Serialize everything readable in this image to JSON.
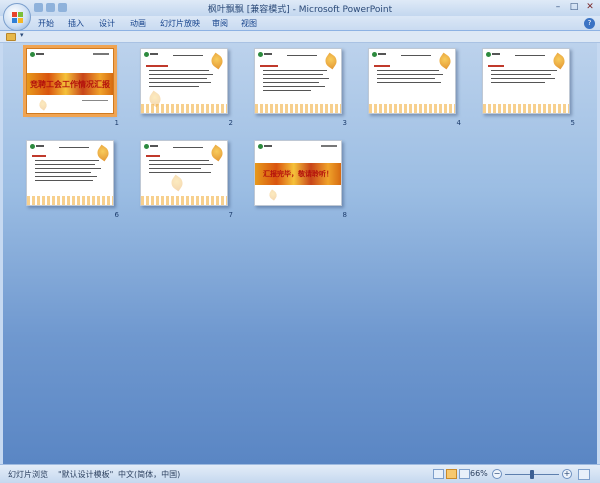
{
  "window": {
    "title": "枫叶飘飘 [兼容模式] - Microsoft PowerPoint",
    "controls": {
      "minimize": "–",
      "maximize": "□",
      "close": "✕"
    }
  },
  "ribbon": {
    "tabs": [
      {
        "label": "开始"
      },
      {
        "label": "插入"
      },
      {
        "label": "设计"
      },
      {
        "label": "动画"
      },
      {
        "label": "幻灯片放映"
      },
      {
        "label": "审阅"
      },
      {
        "label": "视图"
      }
    ],
    "help": "?"
  },
  "quick_access": {
    "dropdown": "▾"
  },
  "slides": [
    {
      "number": "1",
      "type": "title",
      "title": "竞聘工会工作情况汇报",
      "selected": true
    },
    {
      "number": "2",
      "type": "content"
    },
    {
      "number": "3",
      "type": "content"
    },
    {
      "number": "4",
      "type": "content"
    },
    {
      "number": "5",
      "type": "content"
    },
    {
      "number": "6",
      "type": "content"
    },
    {
      "number": "7",
      "type": "content"
    },
    {
      "number": "8",
      "type": "title",
      "title": "汇报完毕，敬请聆听！",
      "selected": false
    }
  ],
  "statusbar": {
    "view": "幻灯片浏览",
    "theme": "\"默认设计模板\"",
    "language": "中文(简体，中国)",
    "zoom": "66%",
    "zoom_minus": "−",
    "zoom_plus": "+"
  },
  "colors": {
    "selection": "#f0a452",
    "band_red_text": "#b3100c",
    "sorter_top": "#bcd2ec",
    "sorter_bottom": "#5a86c4"
  }
}
